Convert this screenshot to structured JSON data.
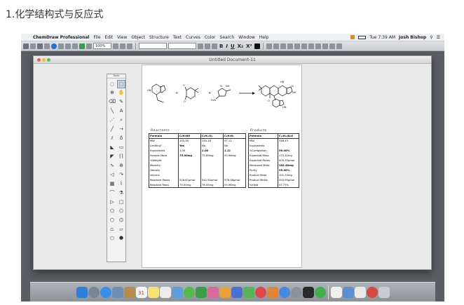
{
  "heading": "1.化学结构式与反应式",
  "menubar": {
    "items": [
      "ChemDraw Professional",
      "File",
      "Edit",
      "View",
      "Object",
      "Structure",
      "Text",
      "Curves",
      "Color",
      "Search",
      "Window",
      "Help"
    ],
    "clock": "Tue 7:39 AM",
    "user": "Josh Bishop"
  },
  "toolbar": {
    "zoom": "100%",
    "format_buttons": [
      "B",
      "I",
      "U",
      "X₂",
      "X²"
    ]
  },
  "window": {
    "title": "Untitled Document-11",
    "palette_title": "Tools"
  },
  "reaction": {
    "plus": "+",
    "atom_labels": [
      "HN",
      "O",
      "O",
      "O",
      "H₂N",
      "N",
      "NH",
      "HN",
      "N",
      "NH",
      "O",
      "HN"
    ]
  },
  "reactants_table": {
    "label": "Reactants",
    "formulas": [
      "C₉H₇NO",
      "C₈H₁₂O₂",
      "C₄H₇N₃"
    ],
    "rows": [
      {
        "label": "Formula",
        "values": [
          "C₉H₇NO",
          "C₈H₁₂O₂",
          "C₄H₇N₃"
        ]
      },
      {
        "label": "MW",
        "values": [
          "145.16",
          "140.18",
          "97.12"
        ]
      },
      {
        "label": "Limiting?",
        "values": [
          "Yes",
          "No",
          "No"
        ]
      },
      {
        "label": "Equivalents",
        "values": [
          "1.00",
          "1.00",
          "1.11"
        ]
      },
      {
        "label": "Sample Mass",
        "values": [
          "75.00mg",
          "75.00mg",
          "55.96mg"
        ]
      },
      {
        "label": "%Weight",
        "values": [
          "",
          "",
          ""
        ]
      },
      {
        "label": "Molarity",
        "values": [
          "",
          "",
          ""
        ]
      },
      {
        "label": "Density",
        "values": [
          "",
          "",
          ""
        ]
      },
      {
        "label": "Volume",
        "values": [
          "",
          "",
          ""
        ]
      },
      {
        "label": "Reactant Moles",
        "values": [
          "516.67μmol",
          "542.50μmol",
          "576.08μmol"
        ]
      },
      {
        "label": "Reactant Mass",
        "values": [
          "75.00mg",
          "76.05mg",
          "55.96mg"
        ]
      }
    ]
  },
  "products_table": {
    "label": "Products",
    "formula": "C₂₁H₂₂N₄O",
    "rows": [
      {
        "label": "Formula",
        "value": "C₂₁H₂₂N₄O"
      },
      {
        "label": "MW",
        "value": "346.43"
      },
      {
        "label": "Equivalents",
        "value": ""
      },
      {
        "label": "%Completion",
        "value": "50.00%"
      },
      {
        "label": "Expected Mass",
        "value": "175.41mg"
      },
      {
        "label": "Expected Moles",
        "value": "505.33μmol"
      },
      {
        "label": "Measured Mass",
        "value": "102.40mg"
      },
      {
        "label": "Purity",
        "value": "95.00%"
      },
      {
        "label": "Product Mass",
        "value": "101.33mg"
      },
      {
        "label": "Product Moles",
        "value": "292.50μmol"
      },
      {
        "label": "%Yield",
        "value": "57.77%"
      }
    ]
  },
  "dock": {
    "calendar_day": "31"
  }
}
